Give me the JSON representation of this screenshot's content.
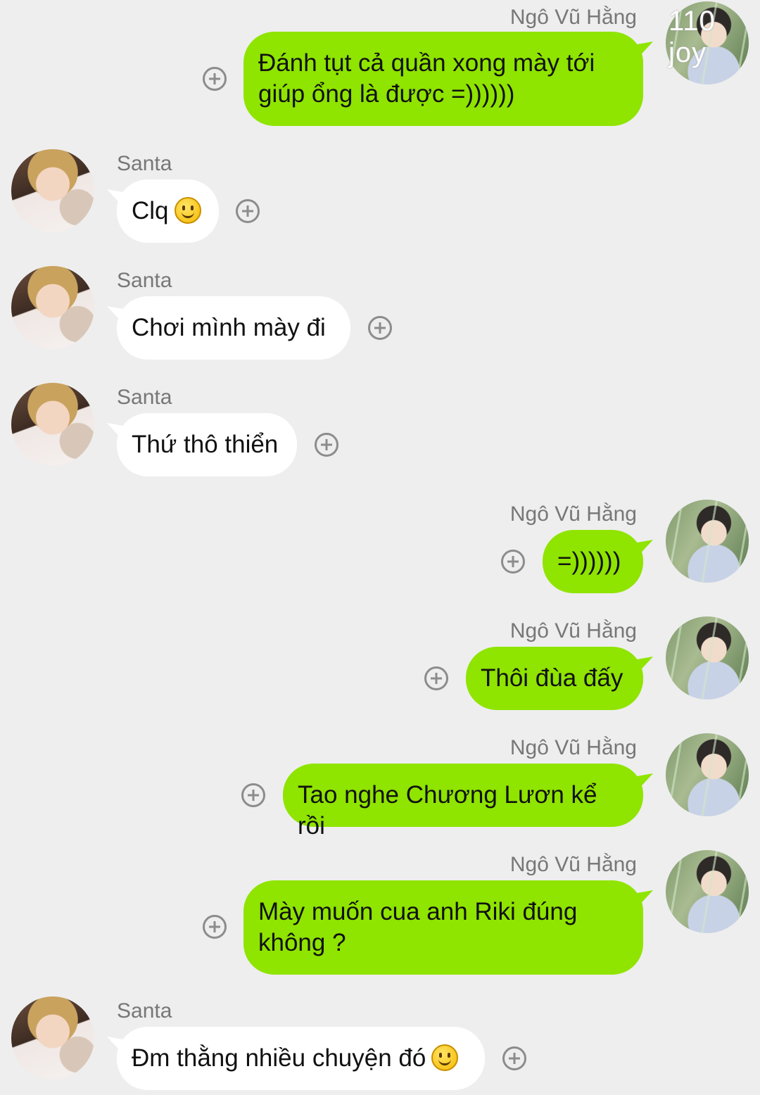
{
  "watermark": "110 joy",
  "messages": [
    {
      "sender": "Ngô Vũ Hằng",
      "text_line1": "Đánh tụt cả quần xong mày tới",
      "text_line2": "giúp ổng là được =))))))"
    },
    {
      "sender": "Santa",
      "text": "Clq",
      "emoji": "smile-emoji"
    },
    {
      "sender": "Santa",
      "text": "Chơi mình mày đi"
    },
    {
      "sender": "Santa",
      "text": "Thứ thô thiển"
    },
    {
      "sender": "Ngô Vũ Hằng",
      "text": "=))))))"
    },
    {
      "sender": "Ngô Vũ Hằng",
      "text": "Thôi đùa đấy"
    },
    {
      "sender": "Ngô Vũ Hằng",
      "text": "Tao nghe Chương Lươn kể rồi"
    },
    {
      "sender": "Ngô Vũ Hằng",
      "text_line1": "Mày muốn cua anh Riki đúng",
      "text_line2": "không ?"
    },
    {
      "sender": "Santa",
      "text": "Đm thằng nhiều chuyện đó",
      "emoji": "smile-emoji"
    }
  ],
  "colors": {
    "background": "#eeeeee",
    "outgoing_bubble": "#8fe400",
    "incoming_bubble": "#ffffff"
  },
  "icons": {
    "react": "add-circle-icon"
  }
}
